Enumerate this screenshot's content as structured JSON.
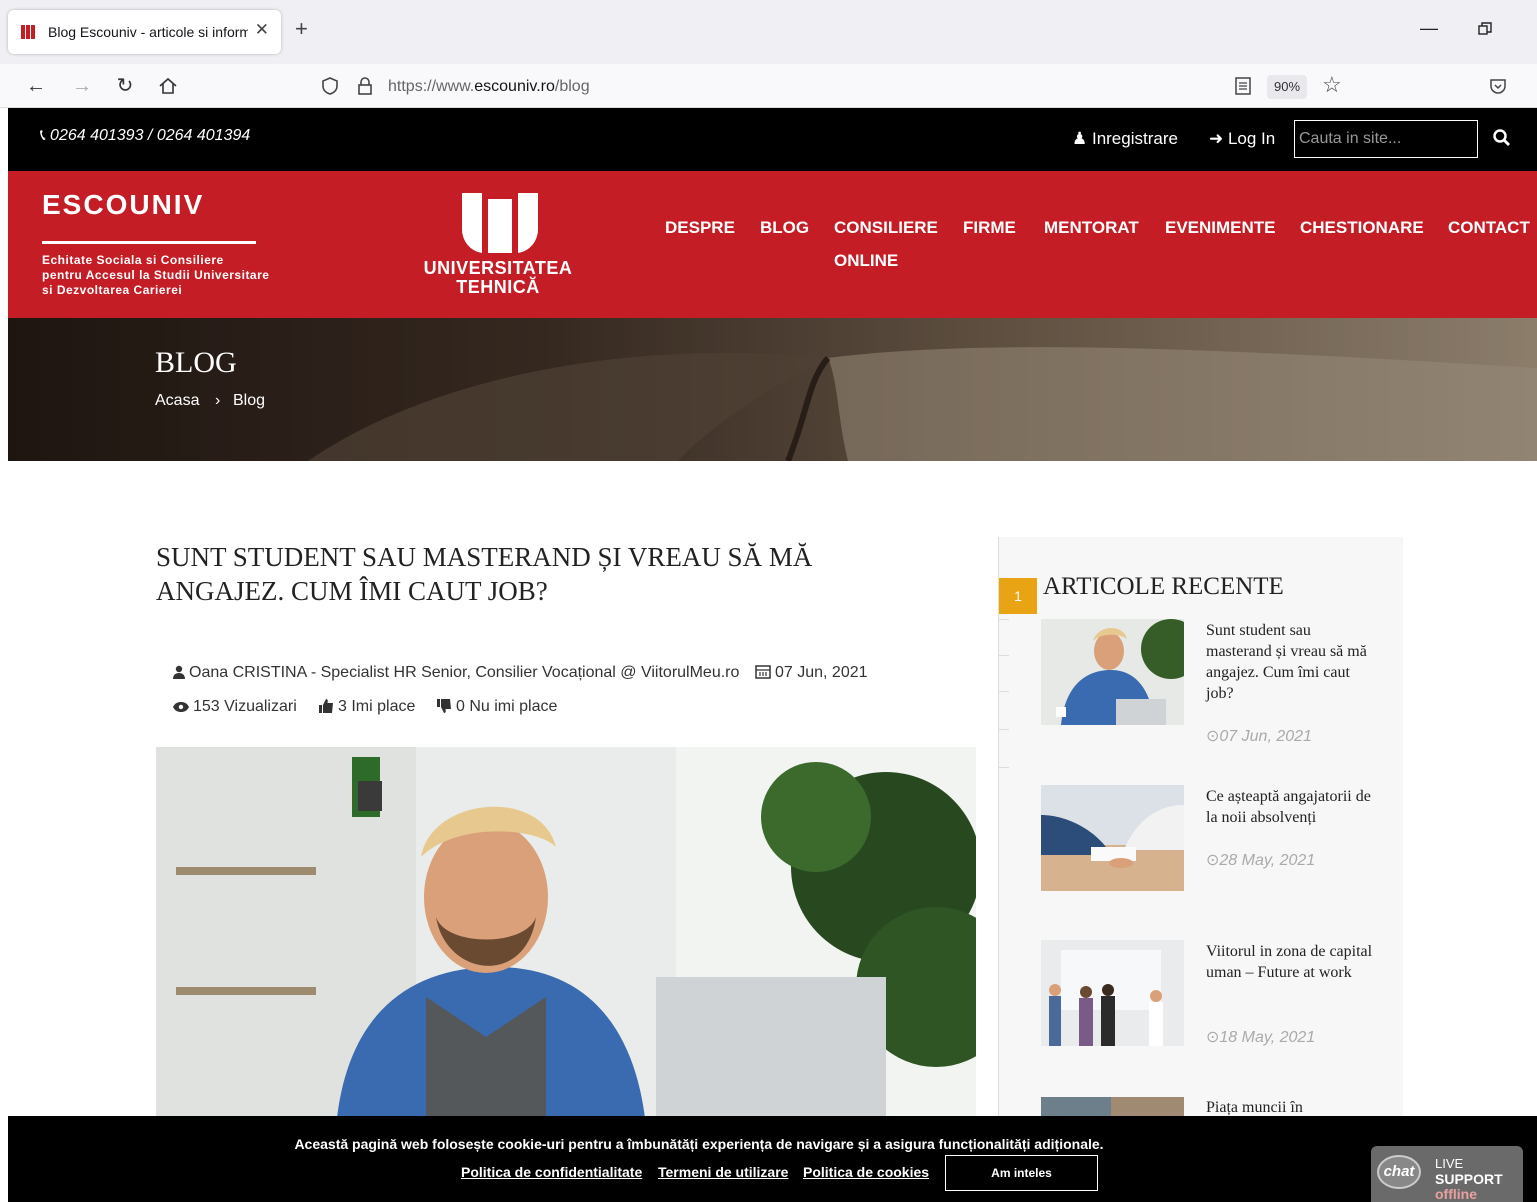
{
  "browser": {
    "tab_title": "Blog Escouniv - articole si informatii",
    "url_prefix": "https://www.",
    "url_domain": "escouniv.ro",
    "url_path": "/blog",
    "zoom": "90%"
  },
  "topbar": {
    "phone": "0264 401393 / 0264 401394",
    "register": "Inregistrare",
    "login": "Log In",
    "search_placeholder": "Cauta in site..."
  },
  "header": {
    "logo_text": "ESCOUNIV",
    "logo_tagline": [
      "Echitate Sociala si Consiliere",
      "pentru Accesul la Studii Universitare",
      "si Dezvoltarea Carierei"
    ],
    "ut_name": [
      "UNIVERSITATEA",
      "TEHNICĂ"
    ],
    "menu": [
      "DESPRE",
      "BLOG",
      "CONSILIERE",
      "ONLINE",
      "FIRME",
      "MENTORAT",
      "EVENIMENTE",
      "CHESTIONARE",
      "CONTACT"
    ]
  },
  "banner": {
    "title": "BLOG",
    "breadcrumb_home": "Acasa",
    "breadcrumb_sep": "›",
    "breadcrumb_current": "Blog"
  },
  "article": {
    "title": "SUNT STUDENT SAU MASTERAND ȘI VREAU SĂ MĂ ANGAJEZ. CUM ÎMI CAUT JOB?",
    "author": "Oana CRISTINA - Specialist HR Senior, Consilier Vocațional @ ViitorulMeu.ro",
    "date": "07 Jun, 2021",
    "views": "153 Vizualizari",
    "likes": "3 Imi place",
    "dislikes": "0 Nu imi place"
  },
  "sidebar": {
    "badge": "1",
    "title": "ARTICOLE RECENTE",
    "posts": [
      {
        "title": "Sunt student sau masterand și vreau să mă angajez. Cum îmi caut job?",
        "date": "07 Jun, 2021"
      },
      {
        "title": "Ce așteaptă angajatorii de la noii absolvenți",
        "date": "28 May, 2021"
      },
      {
        "title": "Viitorul in zona de capital uman – Future at work",
        "date": "18 May, 2021"
      },
      {
        "title": "Piața muncii în",
        "date": ""
      }
    ]
  },
  "cookie": {
    "message": "Această pagină web folosește cookie-uri pentru a îmbunătăți experiența de navigare și a asigura funcționalități adiționale.",
    "link_privacy": "Politica de confidentialitate",
    "link_terms": "Termeni de utilizare",
    "link_cookies": "Politica de cookies",
    "accept": "Am inteles"
  },
  "chat": {
    "bubble": "chat",
    "line1": "LIVE",
    "line2": "SUPPORT",
    "line3": "offline"
  },
  "colors": {
    "brand_red": "#c41d26",
    "badge_orange": "#e9a413",
    "topbar_black": "#000000"
  }
}
